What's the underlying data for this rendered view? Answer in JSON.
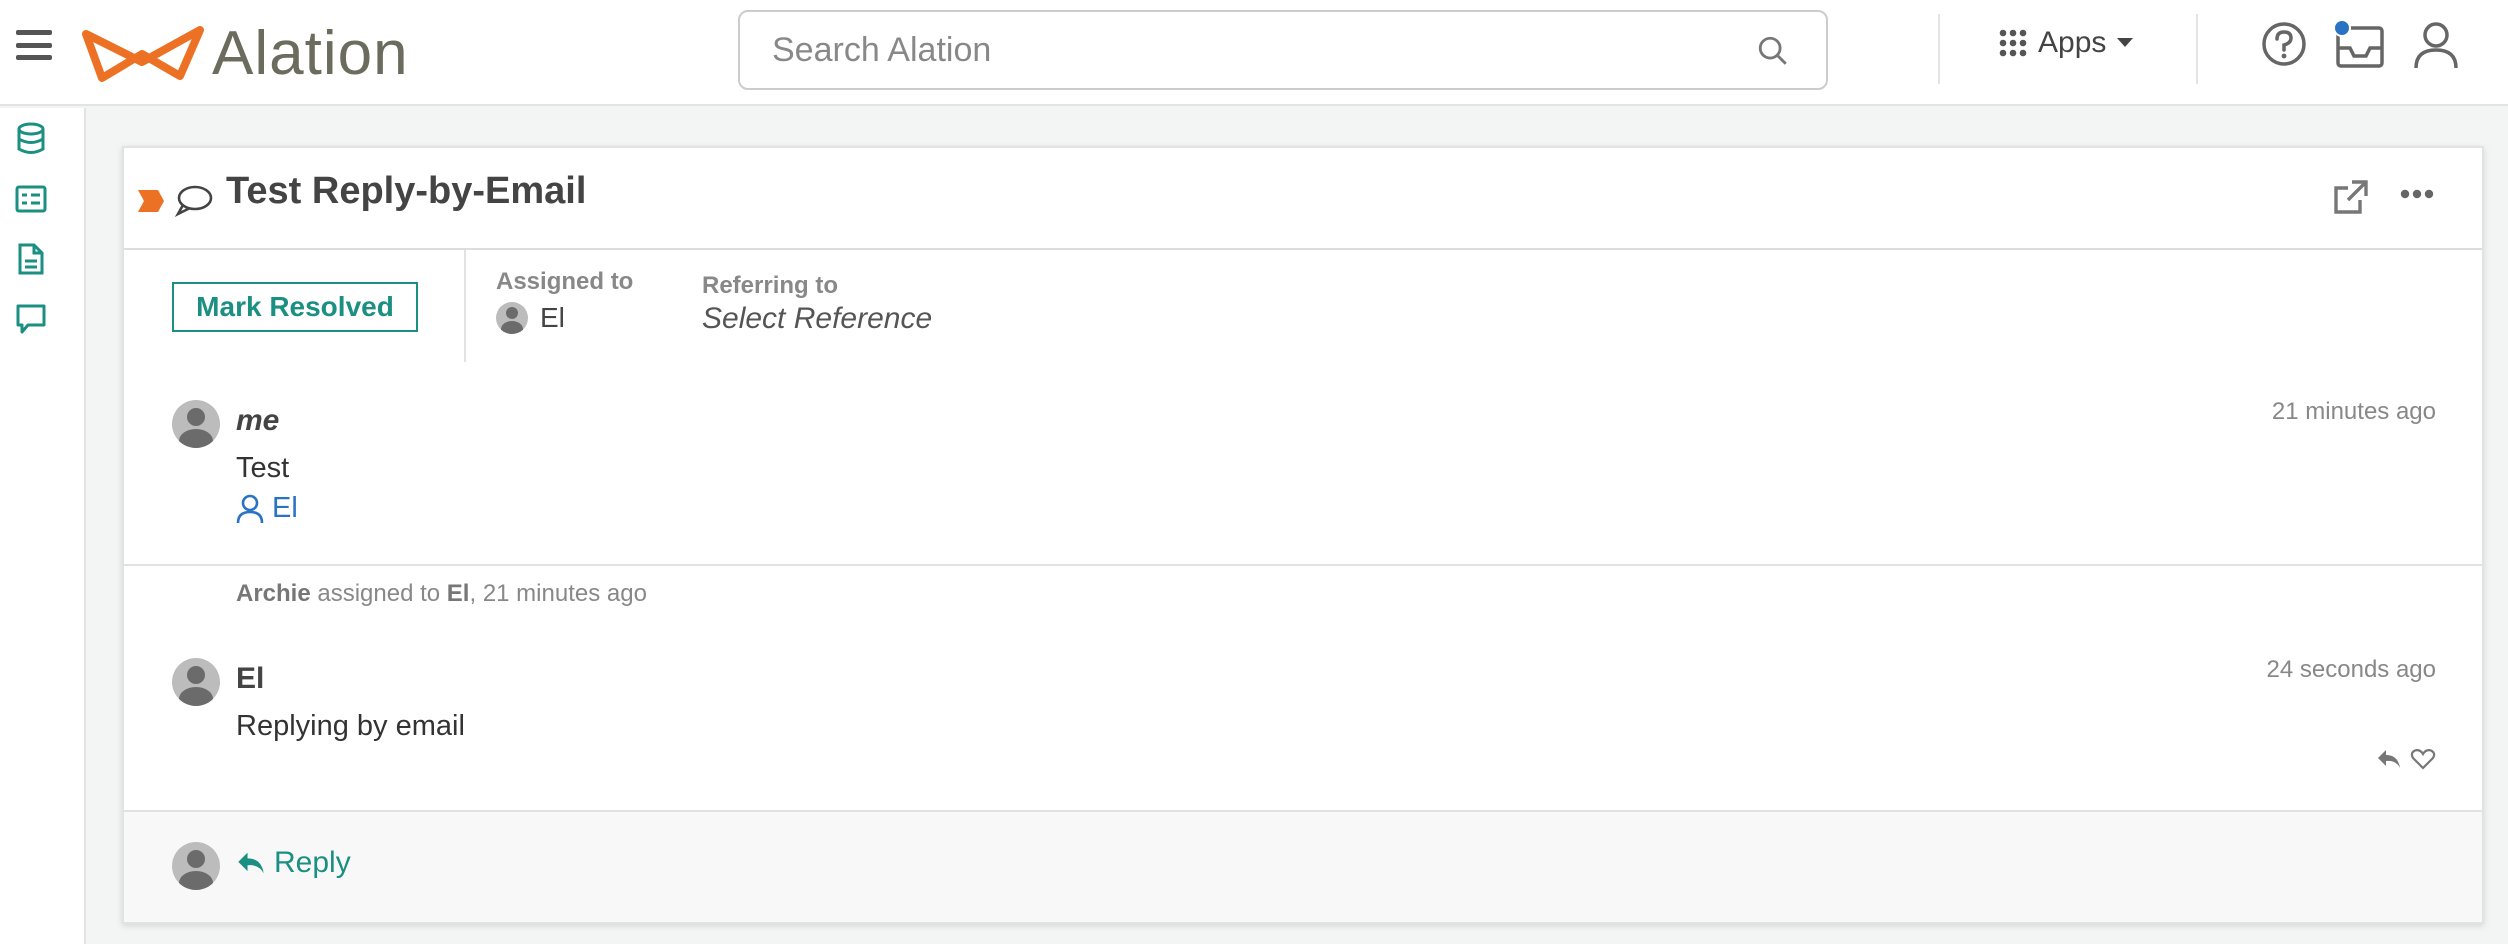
{
  "app": {
    "name": "Alation"
  },
  "search": {
    "placeholder": "Search Alation"
  },
  "nav": {
    "apps_label": "Apps"
  },
  "colors": {
    "accent": "#1b8f82",
    "brand_orange": "#ec7124",
    "link_blue": "#2a73c4",
    "notification_dot": "#2a73c4"
  },
  "sidebar": {
    "items": [
      "database-icon",
      "catalog-card-icon",
      "document-icon",
      "conversation-icon"
    ]
  },
  "conversation": {
    "title": "Test Reply-by-Email",
    "mark_resolved": "Mark Resolved",
    "assigned_to_label": "Assigned to",
    "assigned_to": "El",
    "referring_to_label": "Referring to",
    "referring_to": "Select Reference"
  },
  "messages": [
    {
      "author": "me",
      "time": "21 minutes ago",
      "text": "Test",
      "mention": "El"
    },
    {
      "author": "El",
      "time": "24 seconds ago",
      "text": "Replying by email"
    }
  ],
  "activity": {
    "actor": "Archie",
    "action": " assigned to ",
    "target": "El",
    "suffix": ", 21 minutes ago"
  },
  "footer": {
    "reply_label": "Reply"
  }
}
